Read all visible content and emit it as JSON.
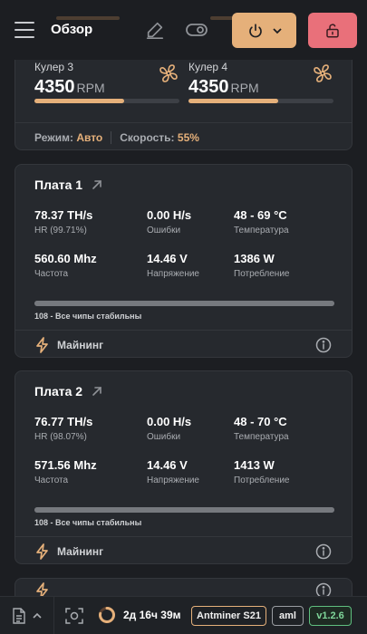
{
  "header": {
    "title": "Обзор"
  },
  "fans": [
    {
      "label": "Кулер 3",
      "value": "4350",
      "unit": "RPM",
      "fill_fraction": 0.62
    },
    {
      "label": "Кулер 4",
      "value": "4350",
      "unit": "RPM",
      "fill_fraction": 0.62
    }
  ],
  "fan_status": {
    "mode_label": "Режим:",
    "mode_value": "Авто",
    "speed_label": "Скорость:",
    "speed_value": "55%"
  },
  "boards": [
    {
      "title": "Плата 1",
      "hashrate": "78.37 TH/s",
      "hr_label": "HR (99.71%)",
      "errors": "0.00 H/s",
      "errors_label": "Ошибки",
      "temp": "48 - 69 °C",
      "temp_label": "Температура",
      "freq": "560.60 Mhz",
      "freq_label": "Частота",
      "voltage": "14.46 V",
      "voltage_label": "Напряжение",
      "power": "1386 W",
      "power_label": "Потребление",
      "chips": "108 - Все чипы стабильны",
      "chip_fraction": 1.0,
      "status": "Майнинг"
    },
    {
      "title": "Плата 2",
      "hashrate": "76.77 TH/s",
      "hr_label": "HR (98.07%)",
      "errors": "0.00 H/s",
      "errors_label": "Ошибки",
      "temp": "48 - 70 °C",
      "temp_label": "Температура",
      "freq": "571.56 Mhz",
      "freq_label": "Частота",
      "voltage": "14.46 V",
      "voltage_label": "Напряжение",
      "power": "1413 W",
      "power_label": "Потребление",
      "chips": "108 - Все чипы стабильны",
      "chip_fraction": 1.0,
      "status": "Майнинг"
    }
  ],
  "footer": {
    "uptime": "2д 16ч 39м",
    "model": "Antminer S21",
    "firmware": "aml",
    "version": "v1.2.6"
  },
  "colors": {
    "accent": "#e5b07a",
    "danger": "#e9707a",
    "ok": "#5fbf7f"
  }
}
